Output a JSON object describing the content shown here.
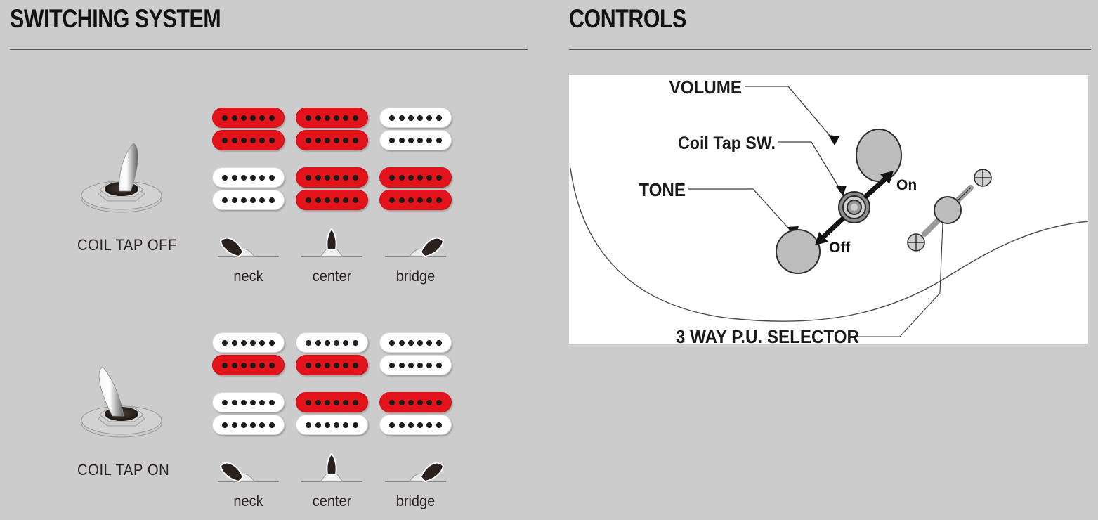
{
  "sections": {
    "switching": {
      "title": "SWITCHING SYSTEM"
    },
    "controls": {
      "title": "CONTROLS"
    }
  },
  "switching_system": {
    "modes": [
      {
        "id": "coil-tap-off",
        "label": "COIL TAP OFF",
        "switch_position": "off",
        "pickup_columns": [
          "neck",
          "center",
          "bridge"
        ],
        "pickup_rows": [
          {
            "position": "neck-pickup",
            "coils": [
              {
                "column": "neck",
                "top": "on",
                "bottom": "on"
              },
              {
                "column": "center",
                "top": "on",
                "bottom": "on"
              },
              {
                "column": "bridge",
                "top": "off",
                "bottom": "off"
              }
            ]
          },
          {
            "position": "bridge-pickup",
            "coils": [
              {
                "column": "neck",
                "top": "off",
                "bottom": "off"
              },
              {
                "column": "center",
                "top": "on",
                "bottom": "on"
              },
              {
                "column": "bridge",
                "top": "on",
                "bottom": "on"
              }
            ]
          }
        ],
        "selector_labels": [
          "neck",
          "center",
          "bridge"
        ],
        "selector_states": [
          "left",
          "up",
          "right"
        ]
      },
      {
        "id": "coil-tap-on",
        "label": "COIL TAP ON",
        "switch_position": "on",
        "pickup_columns": [
          "neck",
          "center",
          "bridge"
        ],
        "pickup_rows": [
          {
            "position": "neck-pickup",
            "coils": [
              {
                "column": "neck",
                "top": "off",
                "bottom": "on"
              },
              {
                "column": "center",
                "top": "off",
                "bottom": "on"
              },
              {
                "column": "bridge",
                "top": "off",
                "bottom": "off"
              }
            ]
          },
          {
            "position": "bridge-pickup",
            "coils": [
              {
                "column": "neck",
                "top": "off",
                "bottom": "off"
              },
              {
                "column": "center",
                "top": "on",
                "bottom": "off"
              },
              {
                "column": "bridge",
                "top": "on",
                "bottom": "off"
              }
            ]
          }
        ],
        "selector_labels": [
          "neck",
          "center",
          "bridge"
        ],
        "selector_states": [
          "left",
          "up",
          "right"
        ]
      }
    ],
    "poles_per_coil": 6,
    "colors": {
      "active_coil": "#e3131b",
      "inactive_coil": "#ffffff",
      "pole_piece": "#1d1a18",
      "background": "#cccccc"
    }
  },
  "controls": {
    "panel_background": "#ffffff",
    "callouts": [
      {
        "id": "volume",
        "label": "VOLUME"
      },
      {
        "id": "coil-tap-sw",
        "label": "Coil Tap SW."
      },
      {
        "id": "tone",
        "label": "TONE"
      },
      {
        "id": "pu-selector",
        "label": "3 WAY P.U. SELECTOR"
      }
    ],
    "switch_states": [
      {
        "id": "coil-tap-on-state",
        "label": "On",
        "direction": "up-right"
      },
      {
        "id": "coil-tap-off-state",
        "label": "Off",
        "direction": "down-left"
      }
    ],
    "knobs": [
      {
        "id": "volume-knob",
        "shape": "ellipse",
        "fill": "#bbbbbb"
      },
      {
        "id": "tone-knob",
        "shape": "circle",
        "fill": "#bbbbbb"
      }
    ]
  }
}
